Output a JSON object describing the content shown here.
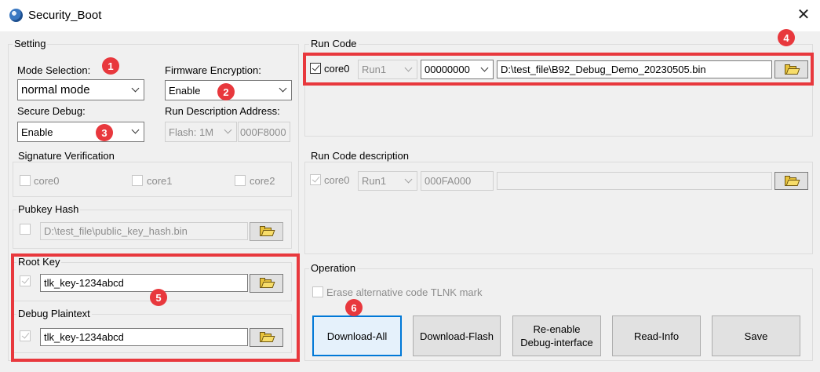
{
  "window": {
    "title": "Security_Boot",
    "close_symbol": "✕"
  },
  "setting": {
    "group_label": "Setting",
    "mode_selection": {
      "label": "Mode Selection:",
      "value": "normal mode"
    },
    "firmware_encryption": {
      "label": "Firmware Encryption:",
      "value": "Enable"
    },
    "secure_debug": {
      "label": "Secure Debug:",
      "value": "Enable"
    },
    "run_description_address": {
      "label": "Run Description Address:",
      "flash_value": "Flash: 1M",
      "address": "000F8000"
    },
    "signature_verification": {
      "label": "Signature  Verification",
      "cores": [
        "core0",
        "core1",
        "core2"
      ]
    },
    "pubkey_hash": {
      "label": "Pubkey Hash",
      "path": "D:\\test_file\\public_key_hash.bin"
    },
    "root_key": {
      "label": "Root Key",
      "value": "tlk_key-1234abcd"
    },
    "debug_plaintext": {
      "label": "Debug Plaintext",
      "value": "tlk_key-1234abcd"
    }
  },
  "run_code": {
    "group_label": "Run Code",
    "core_label": "core0",
    "run_value": "Run1",
    "address": "00000000",
    "path": "D:\\test_file\\B92_Debug_Demo_20230505.bin"
  },
  "run_code_description": {
    "group_label": "Run Code description",
    "core_label": "core0",
    "run_value": "Run1",
    "address": "000FA000",
    "path": ""
  },
  "operation": {
    "group_label": "Operation",
    "erase_label": "Erase alternative code TLNK mark",
    "buttons": {
      "download_all": "Download-All",
      "download_flash": "Download-Flash",
      "reenable_line1": "Re-enable",
      "reenable_line2": "Debug-interface",
      "read_info": "Read-Info",
      "save": "Save"
    }
  },
  "annotations": [
    "1",
    "2",
    "3",
    "4",
    "5",
    "6"
  ],
  "colors": {
    "highlight": "#e8383d",
    "default_button_border": "#0078d7",
    "background": "#f0f0f0"
  }
}
